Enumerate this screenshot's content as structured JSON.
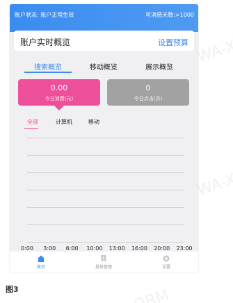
{
  "header": {
    "account_status": "账户状态: 账户正常生效",
    "days_available": "可消费天数:>1000"
  },
  "overview": {
    "title": "账户实时概览",
    "budget_link": "设置预算"
  },
  "tabs": [
    {
      "label": "搜索概览",
      "active": true
    },
    {
      "label": "移动概览",
      "active": false
    },
    {
      "label": "展示概览",
      "active": false
    }
  ],
  "stats": {
    "spend": {
      "value": "0.00",
      "label": "今日消费(元)",
      "color": "#ee4f9a"
    },
    "clicks": {
      "value": "0",
      "label": "今日点击(次)",
      "color": "#a2a2a2"
    }
  },
  "device_tabs": [
    {
      "label": "全部",
      "active": true
    },
    {
      "label": "计算机",
      "active": false
    },
    {
      "label": "移动",
      "active": false
    }
  ],
  "chart_data": {
    "type": "line",
    "categories": [
      "0:00",
      "3:00",
      "6:00",
      "10:00",
      "13:00",
      "16:00",
      "20:00",
      "23:00"
    ],
    "series": [],
    "grid": true
  },
  "bottom_nav": [
    {
      "label": "首页",
      "icon": "home-icon",
      "active": true
    },
    {
      "label": "投放管理",
      "icon": "bookmark-icon",
      "active": false
    },
    {
      "label": "设置",
      "icon": "gear-icon",
      "active": false
    }
  ],
  "caption": "图3",
  "watermarks": [
    "WA-X",
    "WA-X",
    "ORM"
  ],
  "colors": {
    "accent": "#3a8cf0",
    "pink": "#ee4f9a",
    "gray": "#a2a2a2"
  }
}
